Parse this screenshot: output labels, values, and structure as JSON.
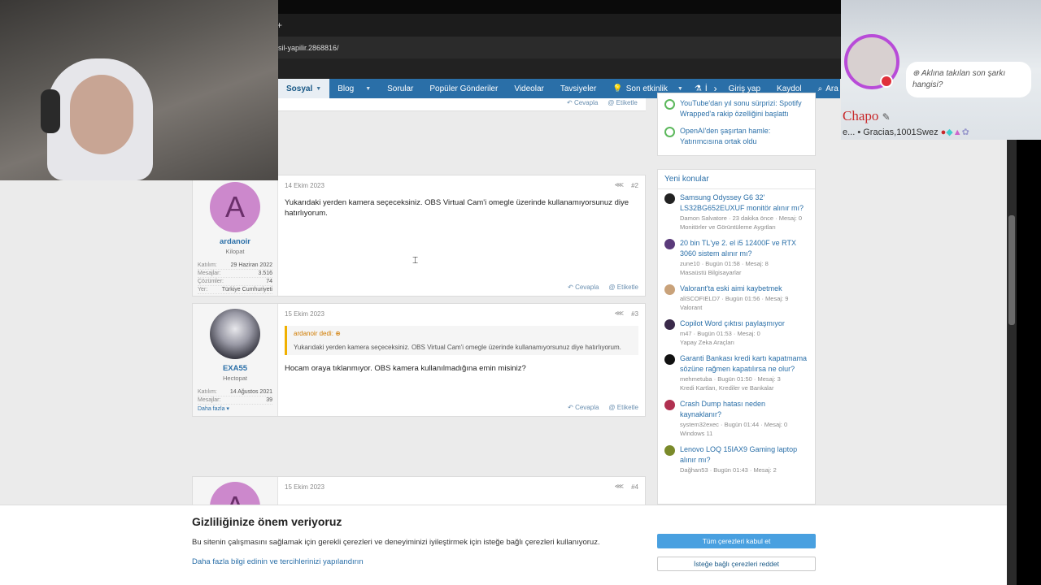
{
  "browser": {
    "url": "sil-yapilir.2868816/",
    "newtab": "+"
  },
  "nav": {
    "items": [
      {
        "label": "Sosyal",
        "caret": true,
        "active": true
      },
      {
        "label": "Blog",
        "caret": true
      },
      {
        "label": "Sorular"
      },
      {
        "label": "Popüler Gönderiler"
      },
      {
        "label": "Videolar"
      },
      {
        "label": "Tavsiyeler"
      },
      {
        "label": "Son etkinlik",
        "caret": true
      },
      {
        "label": "İ"
      }
    ],
    "login": "Giriş yap",
    "register": "Kaydol",
    "search": "Ara"
  },
  "prev_post_actions": {
    "reply": "Cevapla",
    "tag": "Etiketle"
  },
  "posts": [
    {
      "date": "14 Ekim 2023",
      "num": "#2",
      "avatar_letter": "A",
      "username": "ardanoir",
      "usertitle": "Kilopat",
      "stats": [
        [
          "Katılım:",
          "29 Haziran 2022"
        ],
        [
          "Mesajlar:",
          "3.516"
        ],
        [
          "Çözümler:",
          "74"
        ],
        [
          "Yer:",
          "Türkiye Cumhuriyeti"
        ]
      ],
      "message": "Yukarıdaki yerden kamera seçeceksiniz. OBS Virtual Cam'i omegle üzerinde kullanamıyorsunuz diye hatırlıyorum.",
      "reply": "Cevapla",
      "tag": "Etiketle"
    },
    {
      "date": "15 Ekim 2023",
      "num": "#3",
      "username": "EXA55",
      "usertitle": "Hectopat",
      "stats": [
        [
          "Katılım:",
          "14 Ağustos 2021"
        ],
        [
          "Mesajlar:",
          "39"
        ]
      ],
      "more": "Daha fazla",
      "quote_author": "ardanoir dedi:",
      "quote_text": "Yukarıdaki yerden kamera seçeceksiniz. OBS Virtual Cam'i omegle üzerinde kullanamıyorsunuz diye hatırlıyorum.",
      "message": "Hocam oraya tıklanmıyor. OBS kamera kullanılmadığına emin misiniz?",
      "reply": "Cevapla",
      "tag": "Etiketle"
    },
    {
      "date": "15 Ekim 2023",
      "num": "#4",
      "avatar_letter": "A"
    }
  ],
  "sidebar_top": [
    {
      "text": "YouTube'dan yıl sonu sürprizi: Spotify Wrapped'a rakip özelliğini başlattı"
    },
    {
      "text": "OpenAI'den şaşırtan hamle: Yatırımcısına ortak oldu"
    }
  ],
  "new_topics": {
    "title": "Yeni konular",
    "items": [
      {
        "title": "Samsung Odyssey G6 32' LS32BG652EUXUF monitör alınır mı?",
        "meta": "Damon Salvatore · 23 dakika önce · Mesaj: 0",
        "forum": "Monitörler ve Görüntüleme Aygıtları",
        "color": "#222"
      },
      {
        "title": "20 bin TL'ye 2. el i5 12400F ve RTX 3060 sistem alınır mı?",
        "meta": "zune10 · Bugün 01:58 · Mesaj: 8",
        "forum": "Masaüstü Bilgisayarlar",
        "color": "#5a3a7a"
      },
      {
        "title": "Valorant'ta eski aimi kaybetmek",
        "meta": "aliSCOFIELD7 · Bugün 01:56 · Mesaj: 9",
        "forum": "Valorant",
        "color": "#c9a27a"
      },
      {
        "title": "Copilot Word çıktısı paylaşmıyor",
        "meta": "m47 · Bugün 01:53 · Mesaj: 0",
        "forum": "Yapay Zeka Araçları",
        "color": "#3a2a4a"
      },
      {
        "title": "Garanti Bankası kredi kartı kapatmama sözüne rağmen kapatılırsa ne olur?",
        "meta": "mehmetuba · Bugün 01:50 · Mesaj: 3",
        "forum": "Kredi Kartları, Krediler ve Bankalar",
        "color": "#111"
      },
      {
        "title": "Crash Dump hatası neden kaynaklanır?",
        "meta": "system32exec · Bugün 01:44 · Mesaj: 0",
        "forum": "Windows 11",
        "color": "#b03050"
      },
      {
        "title": "Lenovo LOQ 15IAX9 Gaming laptop alınır mı?",
        "meta": "Dağhan53 · Bugün 01:43 · Mesaj: 2",
        "forum": "",
        "color": "#7a8a2a"
      }
    ]
  },
  "cookie": {
    "title": "Gizliliğinize önem veriyoruz",
    "text": "Bu sitenin çalışmasını sağlamak için gerekli çerezleri ve deneyiminizi iyileştirmek için isteğe bağlı çerezleri kullanıyoruz.",
    "link": "Daha fazla bilgi edinin ve tercihlerinizi yapılandırın",
    "accept": "Tüm çerezleri kabul et",
    "reject": "İsteğe bağlı çerezleri reddet"
  },
  "stream_overlay": {
    "question": "Aklına takılan son şarkı hangisi?",
    "name": "Chapo",
    "sub": "e... • Gracias,1001Swez"
  },
  "colors": {
    "nav": "#2a6fa8",
    "accent": "#49a0e0",
    "quote": "#f0b000"
  }
}
